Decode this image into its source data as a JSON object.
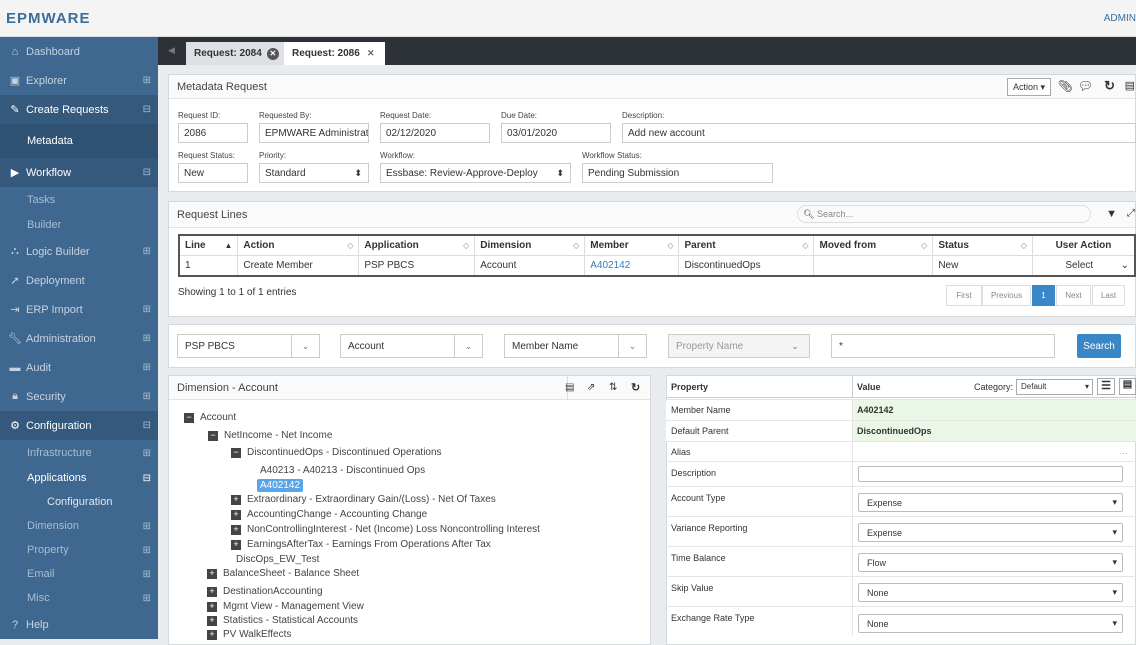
{
  "app": {
    "logo": "EPMWARE",
    "user": "ADMIN"
  },
  "sidebar": {
    "dashboard": "Dashboard",
    "explorer": "Explorer",
    "create_requests": "Create Requests",
    "metadata": "Metadata",
    "workflow": "Workflow",
    "tasks": "Tasks",
    "builder": "Builder",
    "logic_builder": "Logic Builder",
    "deployment": "Deployment",
    "erp_import": "ERP Import",
    "administration": "Administration",
    "audit": "Audit",
    "security": "Security",
    "configuration": "Configuration",
    "infrastructure": "Infrastructure",
    "applications": "Applications",
    "configuration_sub": "Configuration",
    "dimension": "Dimension",
    "property": "Property",
    "email": "Email",
    "misc": "Misc",
    "help": "Help",
    "toggle_plus": "⊞",
    "toggle_minus": "⊟"
  },
  "tabs": [
    {
      "label": "Request: 2084"
    },
    {
      "label": "Request: 2086"
    }
  ],
  "metadata_request": {
    "title": "Metadata Request",
    "action_label": "Action ▾",
    "fields": {
      "request_id_label": "Request ID:",
      "request_id": "2086",
      "requested_by_label": "Requested By:",
      "requested_by": "EPMWARE Administrati",
      "request_date_label": "Request Date:",
      "request_date": "02/12/2020",
      "due_date_label": "Due Date:",
      "due_date": "03/01/2020",
      "description_label": "Description:",
      "description": "Add new account",
      "status_label": "Request Status:",
      "status": "New",
      "priority_label": "Priority:",
      "priority": "Standard",
      "workflow_label": "Workflow:",
      "workflow": "Essbase: Review-Approve-Deploy",
      "workflow_status_label": "Workflow Status:",
      "workflow_status": "Pending Submission"
    }
  },
  "request_lines": {
    "title": "Request Lines",
    "search_placeholder": "Search...",
    "columns": [
      "Line",
      "Action",
      "Application",
      "Dimension",
      "Member",
      "Parent",
      "Moved from",
      "Status",
      "User Action"
    ],
    "rows": [
      [
        "1",
        "Create Member",
        "PSP PBCS",
        "Account",
        "A402142",
        "DiscontinuedOps",
        "",
        "New",
        "Select"
      ]
    ],
    "showing": "Showing 1 to 1 of 1 entries",
    "pager": [
      "First",
      "Previous",
      "1",
      "Next",
      "Last"
    ]
  },
  "filters": {
    "application": "PSP PBCS",
    "dimension": "Account",
    "member_name": "Member Name",
    "property_name": "Property Name",
    "search_value": "*",
    "search_button": "Search"
  },
  "tree_panel": {
    "title": "Dimension - Account",
    "nodes": [
      "Account",
      "NetIncome - Net Income",
      "DiscontinuedOps - Discontinued Operations",
      "A40213 - A40213 - Discontinued Ops",
      "A402142",
      "Extraordinary - Extraordinary Gain/(Loss) - Net Of Taxes",
      "AccountingChange - Accounting Change",
      "NonControllingInterest - Net (Income) Loss Noncontrolling Interest",
      "EarningsAfterTax - Earnings From Operations After Tax",
      "DiscOps_EW_Test",
      "BalanceSheet - Balance Sheet",
      "DestinationAccounting",
      "Mgmt View - Management View",
      "Statistics - Statistical Accounts",
      "PV WalkEffects"
    ]
  },
  "properties": {
    "col_property": "Property",
    "col_value": "Value",
    "category_label": "Category:",
    "category": "Default",
    "rows": [
      {
        "name": "Member Name",
        "value": "A402142"
      },
      {
        "name": "Default Parent",
        "value": "DiscontinuedOps"
      },
      {
        "name": "Alias",
        "value": ""
      },
      {
        "name": "Description",
        "value": ""
      },
      {
        "name": "Account Type",
        "value": "Expense"
      },
      {
        "name": "Variance Reporting",
        "value": "Expense"
      },
      {
        "name": "Time Balance",
        "value": "Flow"
      },
      {
        "name": "Skip Value",
        "value": "None"
      },
      {
        "name": "Exchange Rate Type",
        "value": "None"
      }
    ]
  },
  "colors": {
    "sidebar": "#3e688f",
    "accent": "#3a87c8",
    "highlight_row": "#eaf6e6"
  }
}
